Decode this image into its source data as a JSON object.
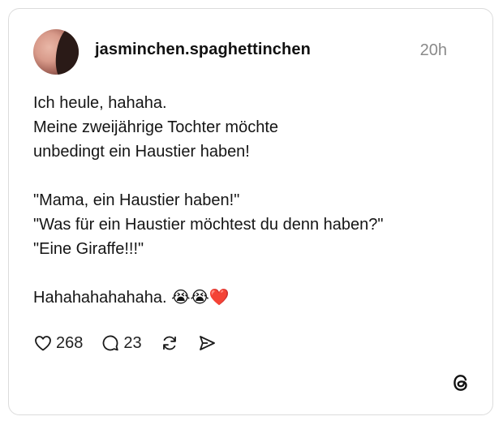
{
  "post": {
    "username": "jasminchen.spaghettinchen",
    "time": "20h",
    "lines": [
      "Ich heule, hahaha.",
      "Meine zweijährige Tochter möchte",
      "unbedingt ein Haustier haben!",
      "",
      "\"Mama, ein Haustier haben!\"",
      "\"Was für ein Haustier möchtest du denn haben?\"",
      "\"Eine Giraffe!!!\"",
      "",
      "Hahahahahahaha. 😭😭❤️"
    ]
  },
  "actions": {
    "likes": "268",
    "replies": "23",
    "icons": [
      "heart-icon",
      "reply-icon",
      "repost-icon",
      "share-icon"
    ]
  },
  "brand": {
    "logo": "threads-logo-icon"
  }
}
